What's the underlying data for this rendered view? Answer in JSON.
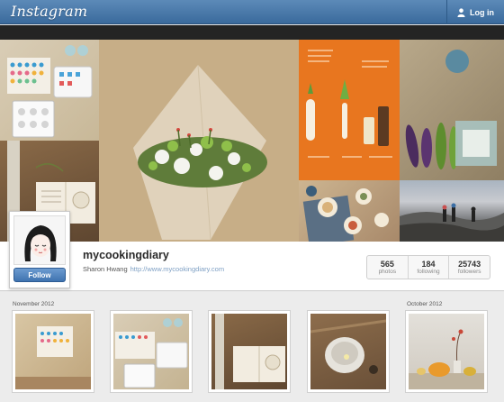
{
  "header": {
    "logo": "Instagram",
    "login_label": "Log in"
  },
  "profile": {
    "username": "mycookingdiary",
    "full_name": "Sharon Hwang",
    "website": "http://www.mycookingdiary.com",
    "follow_label": "Follow",
    "stats": [
      {
        "value": "565",
        "label": "photos"
      },
      {
        "value": "184",
        "label": "following"
      },
      {
        "value": "25743",
        "label": "followers"
      }
    ]
  },
  "feed": {
    "months": [
      "November 2012",
      "October 2012"
    ]
  },
  "colors": {
    "header_blue": "#3f6f9f",
    "follow_blue": "#4a7dbb",
    "link_blue": "#7fa0c4"
  }
}
